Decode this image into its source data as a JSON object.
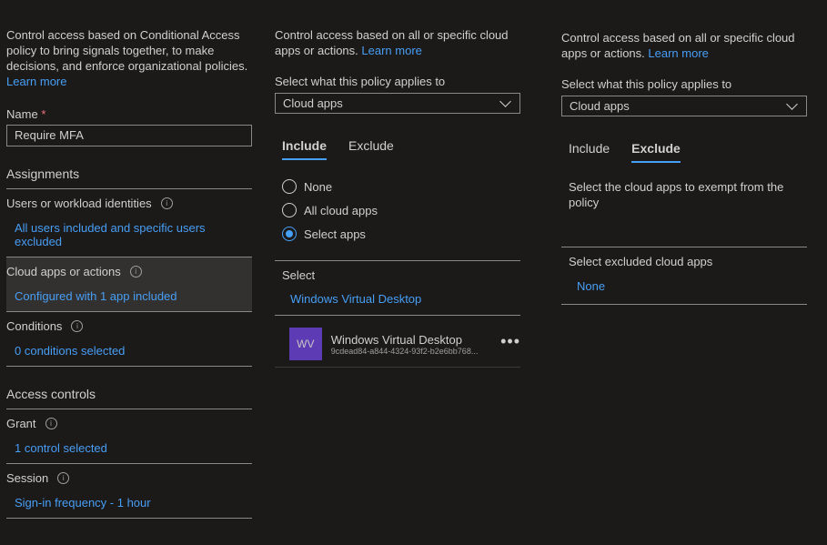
{
  "panel1": {
    "intro": "Control access based on Conditional Access policy to bring signals together, to make decisions, and enforce organizational policies.",
    "learn_more": "Learn more",
    "name_label": "Name",
    "required_marker": "*",
    "name_value": "Require MFA",
    "assignments_heading": "Assignments",
    "users_title": "Users or workload identities",
    "users_value": "All users included and specific users excluded",
    "cloud_title": "Cloud apps or actions",
    "cloud_value": "Configured with 1 app included",
    "conditions_title": "Conditions",
    "conditions_value": "0 conditions selected",
    "access_heading": "Access controls",
    "grant_title": "Grant",
    "grant_value": "1 control selected",
    "session_title": "Session",
    "session_value": "Sign-in frequency - 1 hour"
  },
  "panel2": {
    "intro": "Control access based on all or specific cloud apps or actions.",
    "learn_more": "Learn more",
    "applies_label": "Select what this policy applies to",
    "applies_value": "Cloud apps",
    "tab_include": "Include",
    "tab_exclude": "Exclude",
    "radio_none": "None",
    "radio_all": "All cloud apps",
    "radio_select": "Select apps",
    "select_label": "Select",
    "select_value": "Windows Virtual Desktop",
    "app_tile": "WV",
    "app_name": "Windows Virtual Desktop",
    "app_id": "9cdead84-a844-4324-93f2-b2e6bb768..."
  },
  "panel3": {
    "intro": "Control access based on all or specific cloud apps or actions.",
    "learn_more": "Learn more",
    "applies_label": "Select what this policy applies to",
    "applies_value": "Cloud apps",
    "tab_include": "Include",
    "tab_exclude": "Exclude",
    "description": "Select the cloud apps to exempt from the policy",
    "excluded_label": "Select excluded cloud apps",
    "excluded_value": "None"
  },
  "colors": {
    "background": "#1b1a19",
    "link": "#479ef5",
    "required": "#f1707b",
    "app_tile": "#5c3bb4"
  },
  "icons": [
    "info-icon",
    "chevron-down-icon",
    "more-icon"
  ]
}
